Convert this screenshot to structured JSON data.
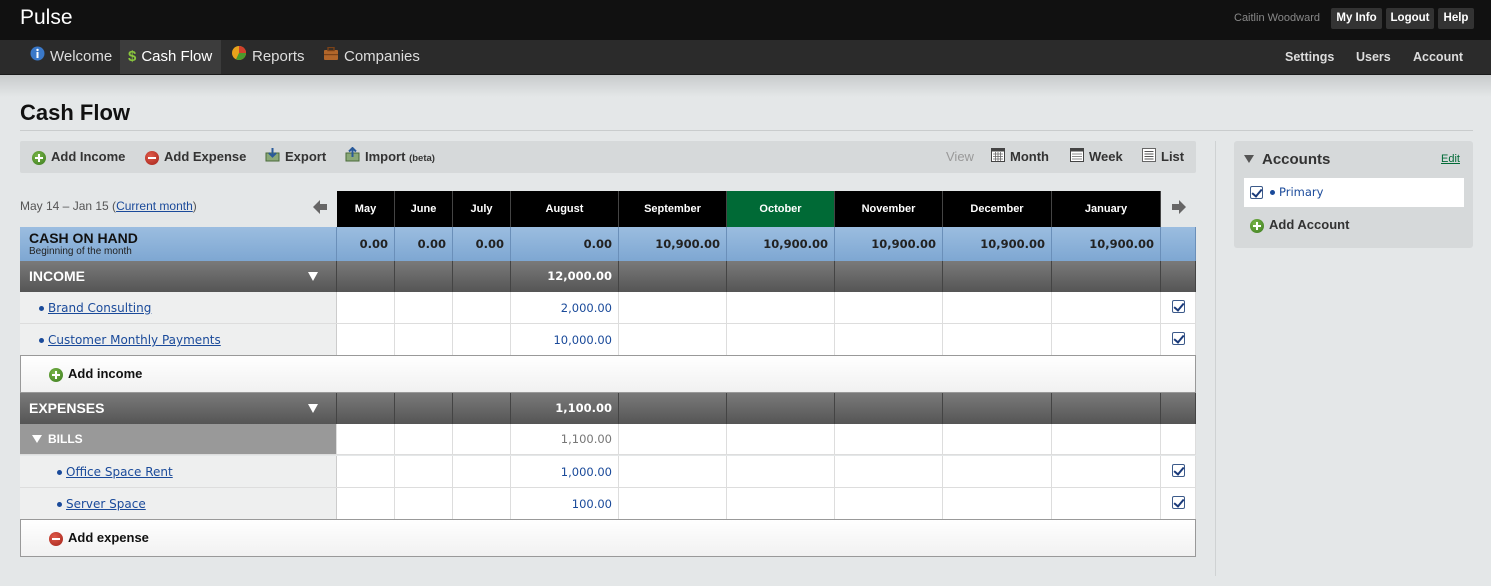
{
  "app": {
    "title": "Pulse"
  },
  "user": {
    "name": "Caitlin Woodward"
  },
  "top_links": [
    "My Info",
    "Logout",
    "Help"
  ],
  "nav": {
    "items": [
      {
        "label": "Welcome",
        "icon": "info-icon"
      },
      {
        "label": "Cash Flow",
        "icon": "dollar-icon",
        "active": true
      },
      {
        "label": "Reports",
        "icon": "pie-chart-icon"
      },
      {
        "label": "Companies",
        "icon": "briefcase-icon"
      }
    ],
    "right": [
      "Settings",
      "Users",
      "Account"
    ]
  },
  "page_title": "Cash Flow",
  "toolbar": {
    "add_income": "Add Income",
    "add_expense": "Add Expense",
    "export": "Export",
    "import": "Import",
    "import_beta": "(beta)",
    "view_label": "View",
    "views": [
      "Month",
      "Week",
      "List"
    ]
  },
  "range": {
    "text": "May 14 – Jan 15 (",
    "link": "Current month",
    "close": ")"
  },
  "months": [
    "May",
    "June",
    "July",
    "August",
    "September",
    "October",
    "November",
    "December",
    "January"
  ],
  "current_month": "October",
  "cash_on_hand": {
    "label": "CASH ON HAND",
    "sub": "Beginning of the month",
    "values": [
      "0.00",
      "0.00",
      "0.00",
      "0.00",
      "10,900.00",
      "10,900.00",
      "10,900.00",
      "10,900.00",
      "10,900.00"
    ]
  },
  "income": {
    "label": "INCOME",
    "totals": [
      "",
      "",
      "",
      "12,000.00",
      "",
      "",
      "",
      "",
      ""
    ],
    "items": [
      {
        "name": "Brand Consulting",
        "values": [
          "",
          "",
          "",
          "2,000.00",
          "",
          "",
          "",
          "",
          ""
        ],
        "checked": true
      },
      {
        "name": "Customer Monthly Payments",
        "values": [
          "",
          "",
          "",
          "10,000.00",
          "",
          "",
          "",
          "",
          ""
        ],
        "checked": true
      }
    ],
    "add_label": "Add income"
  },
  "expenses": {
    "label": "EXPENSES",
    "totals": [
      "",
      "",
      "",
      "1,100.00",
      "",
      "",
      "",
      "",
      ""
    ],
    "group": {
      "name": "BILLS",
      "values": [
        "",
        "",
        "",
        "1,100.00",
        "",
        "",
        "",
        "",
        ""
      ]
    },
    "items": [
      {
        "name": "Office Space Rent",
        "values": [
          "",
          "",
          "",
          "1,000.00",
          "",
          "",
          "",
          "",
          ""
        ],
        "checked": true
      },
      {
        "name": "Server Space",
        "values": [
          "",
          "",
          "",
          "100.00",
          "",
          "",
          "",
          "",
          ""
        ],
        "checked": true
      }
    ],
    "add_label": "Add expense"
  },
  "accounts": {
    "title": "Accounts",
    "edit": "Edit",
    "items": [
      {
        "name": "Primary",
        "checked": true
      }
    ],
    "add_label": "Add Account"
  },
  "colors": {
    "current_month": "#006a36",
    "link": "#1a4a9a",
    "cash_row": "#8bb2d9"
  }
}
